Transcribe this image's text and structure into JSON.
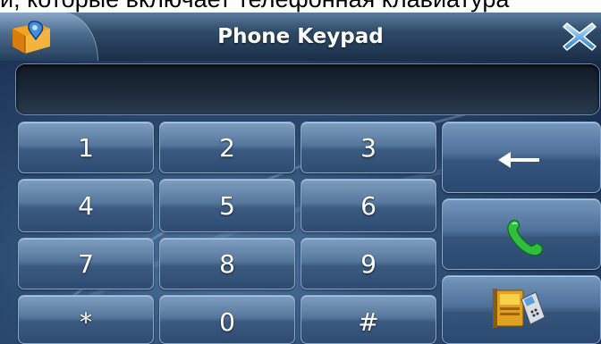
{
  "caption": "и, которые включает телефонная клавиатура",
  "window": {
    "title": "Phone Keypad"
  },
  "display": {
    "value": ""
  },
  "keypad": {
    "keys": [
      {
        "label": "1"
      },
      {
        "label": "2"
      },
      {
        "label": "3"
      },
      {
        "label": "4"
      },
      {
        "label": "5"
      },
      {
        "label": "6"
      },
      {
        "label": "7"
      },
      {
        "label": "8"
      },
      {
        "label": "9"
      },
      {
        "label": "*"
      },
      {
        "label": "0"
      },
      {
        "label": "#"
      }
    ]
  },
  "side_buttons": {
    "backspace_icon": "left-arrow-icon",
    "call_icon": "phone-handset-icon",
    "contacts_icon": "contacts-phonebook-icon"
  },
  "icons": {
    "app": "map-pin-icon",
    "close": "close-x-icon"
  },
  "colors": {
    "call_green": "#2fbf3a",
    "title_text": "#ffffff",
    "close_blue": "#6fb4ea"
  }
}
